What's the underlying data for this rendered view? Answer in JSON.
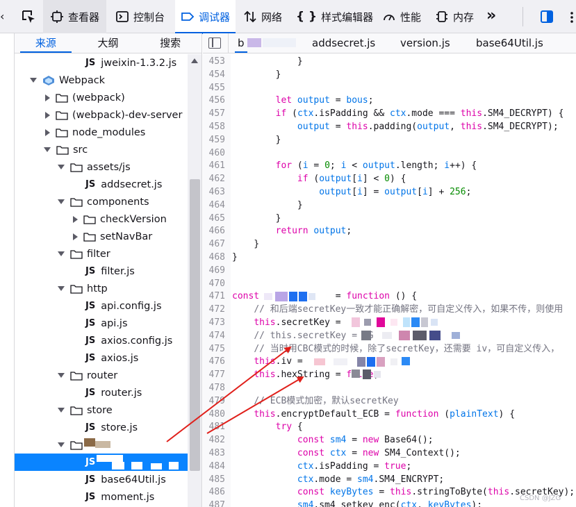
{
  "toolbar": {
    "tabs": [
      {
        "label": "查看器",
        "icon": "inspector-icon"
      },
      {
        "label": "控制台",
        "icon": "console-icon"
      },
      {
        "label": "调试器",
        "icon": "debugger-icon"
      },
      {
        "label": "网络",
        "icon": "network-icon"
      },
      {
        "label": "样式编辑器",
        "icon": "style-editor-icon"
      },
      {
        "label": "性能",
        "icon": "performance-icon"
      },
      {
        "label": "内存",
        "icon": "memory-icon"
      }
    ],
    "more_label": "»",
    "active_color": "#0061e0"
  },
  "left_panel": {
    "tabs": [
      "来源",
      "大纲",
      "搜索"
    ],
    "tree": [
      {
        "label": "jweixin-1.3.2.js",
        "type": "js",
        "depth": 4
      },
      {
        "label": "Webpack",
        "type": "webpack",
        "depth": 1,
        "open": true
      },
      {
        "label": "(webpack)",
        "type": "folder",
        "depth": 2,
        "open": false
      },
      {
        "label": "(webpack)-dev-server",
        "type": "folder",
        "depth": 2,
        "open": false
      },
      {
        "label": "node_modules",
        "type": "folder",
        "depth": 2,
        "open": false
      },
      {
        "label": "src",
        "type": "folder",
        "depth": 2,
        "open": true
      },
      {
        "label": "assets/js",
        "type": "folder",
        "depth": 3,
        "open": true
      },
      {
        "label": "addsecret.js",
        "type": "js",
        "depth": 4
      },
      {
        "label": "components",
        "type": "folder",
        "depth": 3,
        "open": true
      },
      {
        "label": "checkVersion",
        "type": "folder",
        "depth": 4,
        "open": false
      },
      {
        "label": "setNavBar",
        "type": "folder",
        "depth": 4,
        "open": false
      },
      {
        "label": "filter",
        "type": "folder",
        "depth": 3,
        "open": true
      },
      {
        "label": "filter.js",
        "type": "js",
        "depth": 4
      },
      {
        "label": "http",
        "type": "folder",
        "depth": 3,
        "open": true
      },
      {
        "label": "api.config.js",
        "type": "js",
        "depth": 4
      },
      {
        "label": "api.js",
        "type": "js",
        "depth": 4
      },
      {
        "label": "axios.config.js",
        "type": "js",
        "depth": 4
      },
      {
        "label": "axios.js",
        "type": "js",
        "depth": 4
      },
      {
        "label": "router",
        "type": "folder",
        "depth": 3,
        "open": true
      },
      {
        "label": "router.js",
        "type": "js",
        "depth": 4
      },
      {
        "label": "store",
        "type": "folder",
        "depth": 3,
        "open": true
      },
      {
        "label": "store.js",
        "type": "js",
        "depth": 4
      },
      {
        "label": "",
        "type": "folder",
        "depth": 3,
        "open": true,
        "redacted": true
      },
      {
        "label": "",
        "type": "js",
        "depth": 4,
        "selected": true,
        "redacted": true
      },
      {
        "label": "base64Util.js",
        "type": "js",
        "depth": 4
      },
      {
        "label": "moment.js",
        "type": "js",
        "depth": 4
      }
    ],
    "js_badge": "JS",
    "selection_color": "#0a84ff"
  },
  "editor": {
    "tabs": [
      {
        "label": "b",
        "active": true,
        "redacted": true
      },
      {
        "label": "addsecret.js",
        "active": false
      },
      {
        "label": "version.js",
        "active": false
      },
      {
        "label": "base64Util.js",
        "active": false
      }
    ],
    "lines": [
      {
        "n": "453",
        "segs": [
          [
            "",
            "            }"
          ]
        ]
      },
      {
        "n": "454",
        "segs": [
          [
            "",
            "        }"
          ]
        ]
      },
      {
        "n": "455",
        "segs": [
          [
            "",
            ""
          ]
        ]
      },
      {
        "n": "456",
        "segs": [
          [
            "",
            "        "
          ],
          [
            "kw",
            "let"
          ],
          [
            "",
            ""
          ],
          [
            "vr",
            " output"
          ],
          [
            "",
            " = "
          ],
          [
            "vr",
            "bous"
          ],
          [
            "",
            ";"
          ]
        ]
      },
      {
        "n": "457",
        "segs": [
          [
            "",
            "        "
          ],
          [
            "kw",
            "if"
          ],
          [
            "",
            " ("
          ],
          [
            "vr",
            "ctx"
          ],
          [
            "",
            ".isPadding && "
          ],
          [
            "vr",
            "ctx"
          ],
          [
            "",
            ".mode === "
          ],
          [
            "kw",
            "this"
          ],
          [
            "",
            ".SM4_DECRYPT) {"
          ]
        ]
      },
      {
        "n": "458",
        "segs": [
          [
            "",
            "            "
          ],
          [
            "vr",
            "output"
          ],
          [
            "",
            " = "
          ],
          [
            "kw",
            "this"
          ],
          [
            "",
            ".padding("
          ],
          [
            "vr",
            "output"
          ],
          [
            "",
            ", "
          ],
          [
            "kw",
            "this"
          ],
          [
            "",
            ".SM4_DECRYPT);"
          ]
        ]
      },
      {
        "n": "459",
        "segs": [
          [
            "",
            "        }"
          ]
        ]
      },
      {
        "n": "460",
        "segs": [
          [
            "",
            ""
          ]
        ]
      },
      {
        "n": "461",
        "segs": [
          [
            "",
            "        "
          ],
          [
            "kw",
            "for"
          ],
          [
            "",
            " ("
          ],
          [
            "vr",
            "i"
          ],
          [
            "",
            " = "
          ],
          [
            "num",
            "0"
          ],
          [
            "",
            "; "
          ],
          [
            "vr",
            "i"
          ],
          [
            "",
            " < "
          ],
          [
            "vr",
            "output"
          ],
          [
            "",
            ".length; "
          ],
          [
            "vr",
            "i"
          ],
          [
            "",
            "++) {"
          ]
        ]
      },
      {
        "n": "462",
        "segs": [
          [
            "",
            "            "
          ],
          [
            "kw",
            "if"
          ],
          [
            "",
            " ("
          ],
          [
            "vr",
            "output"
          ],
          [
            "",
            "["
          ],
          [
            "vr",
            "i"
          ],
          [
            "",
            "] < "
          ],
          [
            "num",
            "0"
          ],
          [
            "",
            ") {"
          ]
        ]
      },
      {
        "n": "463",
        "segs": [
          [
            "",
            "                "
          ],
          [
            "vr",
            "output"
          ],
          [
            "",
            "["
          ],
          [
            "vr",
            "i"
          ],
          [
            "",
            "] = "
          ],
          [
            "vr",
            "output"
          ],
          [
            "",
            "["
          ],
          [
            "vr",
            "i"
          ],
          [
            "",
            "] + "
          ],
          [
            "num",
            "256"
          ],
          [
            "",
            ";"
          ]
        ]
      },
      {
        "n": "464",
        "segs": [
          [
            "",
            "            }"
          ]
        ]
      },
      {
        "n": "465",
        "segs": [
          [
            "",
            "        }"
          ]
        ]
      },
      {
        "n": "466",
        "segs": [
          [
            "",
            "        "
          ],
          [
            "kw",
            "return"
          ],
          [
            "vr",
            " output"
          ],
          [
            "",
            ";"
          ]
        ]
      },
      {
        "n": "467",
        "segs": [
          [
            "",
            "    }"
          ]
        ]
      },
      {
        "n": "468",
        "segs": [
          [
            "",
            "}"
          ]
        ]
      },
      {
        "n": "469",
        "segs": [
          [
            "",
            ""
          ]
        ]
      },
      {
        "n": "470",
        "segs": [
          [
            "",
            ""
          ]
        ]
      },
      {
        "n": "471",
        "segs": [
          [
            "kw",
            "const"
          ],
          [
            "",
            "              = "
          ],
          [
            "kw",
            "function"
          ],
          [
            "",
            " () {"
          ]
        ]
      },
      {
        "n": "472",
        "segs": [
          [
            "",
            "    "
          ],
          [
            "cm",
            "// 和后端secretKey一致才能正确解密，可自定义传入，如果不传，则使用"
          ]
        ]
      },
      {
        "n": "473",
        "segs": [
          [
            "",
            "    "
          ],
          [
            "kw",
            "this"
          ],
          [
            "",
            ".secretKey = "
          ]
        ]
      },
      {
        "n": "474",
        "segs": [
          [
            "",
            "    "
          ],
          [
            "cm",
            "// this.secretKey = \"G"
          ]
        ]
      },
      {
        "n": "475",
        "segs": [
          [
            "",
            "    "
          ],
          [
            "cm",
            "// 当时用CBC模式的时候，除了secretKey，还需要 iv，可自定义传入，"
          ]
        ]
      },
      {
        "n": "476",
        "segs": [
          [
            "",
            "    "
          ],
          [
            "kw",
            "this"
          ],
          [
            "",
            ".iv = "
          ]
        ]
      },
      {
        "n": "477",
        "segs": [
          [
            "",
            "    "
          ],
          [
            "kw",
            "this"
          ],
          [
            "",
            ".hexString = "
          ],
          [
            "kw",
            "false"
          ],
          [
            "",
            ";"
          ]
        ]
      },
      {
        "n": "478",
        "segs": [
          [
            "",
            ""
          ]
        ]
      },
      {
        "n": "479",
        "segs": [
          [
            "",
            "    "
          ],
          [
            "cm",
            "// ECB模式加密，默认secretKey"
          ]
        ]
      },
      {
        "n": "480",
        "segs": [
          [
            "",
            "    "
          ],
          [
            "kw",
            "this"
          ],
          [
            "",
            ".encryptDefault_ECB = "
          ],
          [
            "kw",
            "function"
          ],
          [
            "",
            " ("
          ],
          [
            "vr",
            "plainText"
          ],
          [
            "",
            ") {"
          ]
        ]
      },
      {
        "n": "481",
        "segs": [
          [
            "",
            "        "
          ],
          [
            "kw",
            "try"
          ],
          [
            "",
            " {"
          ]
        ]
      },
      {
        "n": "482",
        "segs": [
          [
            "",
            "            "
          ],
          [
            "kw",
            "const"
          ],
          [
            "vr",
            " sm4"
          ],
          [
            "",
            " = "
          ],
          [
            "kw",
            "new"
          ],
          [
            "",
            " Base64();"
          ]
        ]
      },
      {
        "n": "483",
        "segs": [
          [
            "",
            "            "
          ],
          [
            "kw",
            "const"
          ],
          [
            "vr",
            " ctx"
          ],
          [
            "",
            " = "
          ],
          [
            "kw",
            "new"
          ],
          [
            "",
            " SM4_Context();"
          ]
        ]
      },
      {
        "n": "484",
        "segs": [
          [
            "",
            "            "
          ],
          [
            "vr",
            "ctx"
          ],
          [
            "",
            ".isPadding = "
          ],
          [
            "kw",
            "true"
          ],
          [
            "",
            ";"
          ]
        ]
      },
      {
        "n": "485",
        "segs": [
          [
            "",
            "            "
          ],
          [
            "vr",
            "ctx"
          ],
          [
            "",
            ".mode = "
          ],
          [
            "vr",
            "sm4"
          ],
          [
            "",
            ".SM4_ENCRYPT;"
          ]
        ]
      },
      {
        "n": "486",
        "segs": [
          [
            "",
            "            "
          ],
          [
            "kw",
            "const"
          ],
          [
            "vr",
            " keyBytes"
          ],
          [
            "",
            " = "
          ],
          [
            "kw",
            "this"
          ],
          [
            "",
            ".stringToByte("
          ],
          [
            "kw",
            "this"
          ],
          [
            "",
            ".secretKey);"
          ]
        ]
      },
      {
        "n": "487",
        "segs": [
          [
            "",
            "            "
          ],
          [
            "vr",
            "sm4"
          ],
          [
            "",
            ".sm4_setkey_enc("
          ],
          [
            "vr",
            "ctx"
          ],
          [
            "",
            ", "
          ],
          [
            "vr",
            "keyBytes"
          ],
          [
            "",
            ");"
          ]
        ]
      }
    ],
    "colors": {
      "keyword": "#dd00a9",
      "variable": "#0074e8",
      "comment": "#737380",
      "number": "#058b00"
    }
  },
  "watermark": "CSDN @JZG",
  "annotation": {
    "arrow_color": "#e0201b"
  }
}
